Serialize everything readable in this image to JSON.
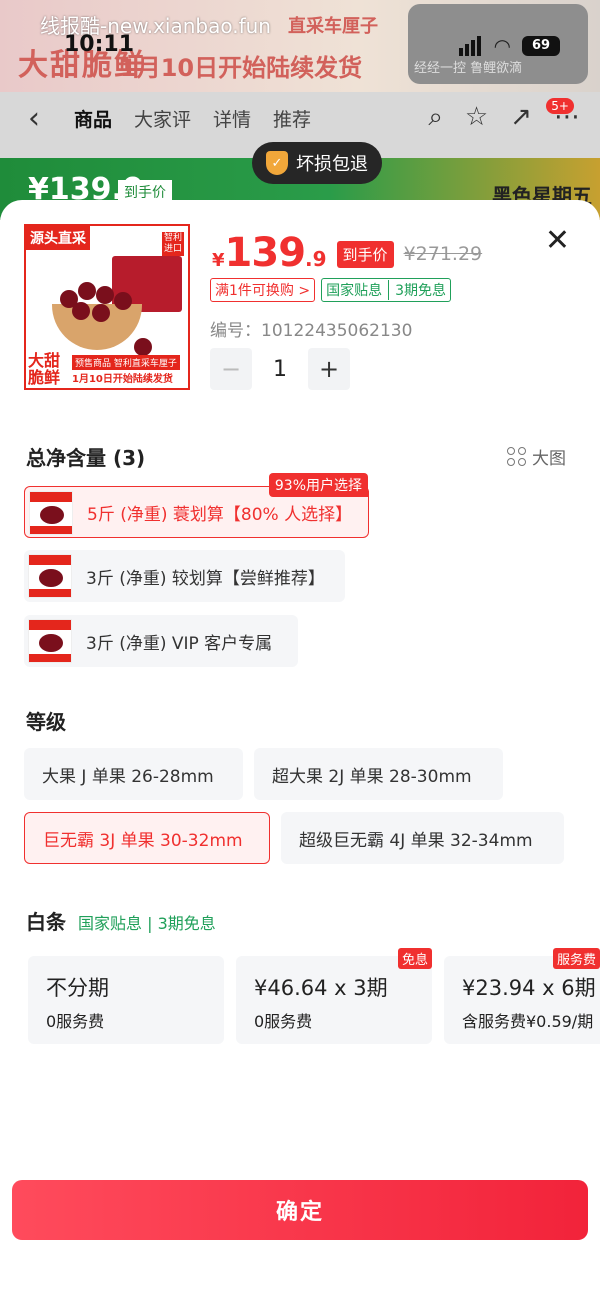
{
  "background": {
    "watermark": "线报酷-new.xianbao.fun",
    "status_time": "10:11",
    "battery": "69",
    "banner_title": "大甜脆鲜",
    "banner_sub": "1月10日开始陆续发货",
    "banner_tag": "直采车厘子",
    "thumb_text": "经经一控 鲁鲤欲滴",
    "tabs": [
      "商品",
      "大家评",
      "详情",
      "推荐"
    ],
    "notif_badge": "5+",
    "strip_price": "¥139.9",
    "strip_tag": "到手价",
    "strip_right": "黑色星期五",
    "toast": "坏损包退"
  },
  "product": {
    "image_tag_tl": "源头直采",
    "image_tag_tr": "智利进口",
    "image_big": "大甜脆鲜",
    "image_presale": "预售商品 智利直采车厘子",
    "image_date": "1月10日开始陆续发货",
    "price_symbol": "¥",
    "price_int": "139",
    "price_dec": ".9",
    "price_tag": "到手价",
    "price_orig": "¥271.29",
    "promo_red": "满1件可换购 >",
    "promo_green_a": "国家贴息",
    "promo_green_b": "3期免息",
    "sku_no": "编号：10122435062130",
    "quantity": "1",
    "minus": "−",
    "plus": "+"
  },
  "volume": {
    "title": "总净含量 (3)",
    "big_view": "大图",
    "options": [
      {
        "label": "5斤 (净重) 蓑划算【80% 人选择】",
        "badge": "93%用户选择"
      },
      {
        "label": "3斤 (净重) 较划算【尝鲜推荐】"
      },
      {
        "label": "3斤 (净重) VIP 客户专属"
      }
    ]
  },
  "grade": {
    "title": "等级",
    "options": [
      "大果 J 单果 26-28mm",
      "超大果 2J 单果 28-30mm",
      "巨无霸 3J 单果 30-32mm",
      "超级巨无霸 4J 单果 32-34mm"
    ]
  },
  "payment": {
    "title": "白条",
    "subtitle": "国家贴息 | 3期免息",
    "cards": [
      {
        "line1": "不分期",
        "line2": "0服务费",
        "tag": ""
      },
      {
        "line1": "¥46.64 x 3期",
        "line2": "0服务费",
        "tag": "免息"
      },
      {
        "line1": "¥23.94 x 6期",
        "line2": "含服务费¥0.59/期",
        "tag": "服务费"
      }
    ]
  },
  "confirm_label": "确定",
  "colors": {
    "accent": "#f0302f",
    "green": "#20a05a"
  }
}
